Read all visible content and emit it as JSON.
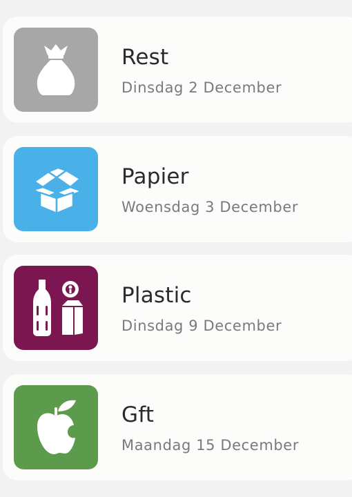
{
  "pickups": [
    {
      "name": "Rest",
      "date": "Dinsdag 2 December",
      "icon": "trash-bag-icon",
      "color": "#a7a7a7"
    },
    {
      "name": "Papier",
      "date": "Woensdag 3 December",
      "icon": "cardboard-box-icon",
      "color": "#4ab0e8"
    },
    {
      "name": "Plastic",
      "date": "Dinsdag 9 December",
      "icon": "bottle-and-carton-icon",
      "color": "#7c1650"
    },
    {
      "name": "Gft",
      "date": "Maandag 15 December",
      "icon": "apple-icon",
      "color": "#5c9a4c"
    }
  ]
}
